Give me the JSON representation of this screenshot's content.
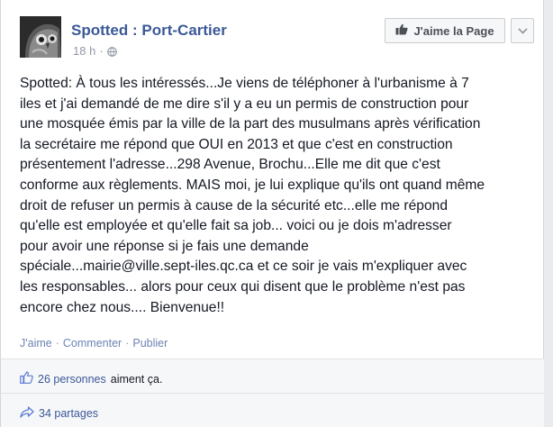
{
  "post": {
    "page_name": "Spotted : Port-Cartier",
    "time": "18 h",
    "meta_sep": "·",
    "like_page_label": "J'aime la Page",
    "text": "Spotted: À tous les intéressés...Je viens de téléphoner à l'urbanisme à 7\niles et j'ai demandé de me dire s'il y a eu un permis de construction pour\nune mosquée émis par la ville de la part des musulmans après vérification\nla secrétaire me répond que OUI en 2013 et que c'est en construction\nprésentement l'adresse...298 Avenue, Brochu...Elle me dit que c'est\nconforme aux règlements. MAIS moi, je lui explique qu'ils ont quand même\ndroit de refuser un permis à cause de la sécurité etc...elle me répond\nqu'elle est employée et qu'elle fait sa job... voici ou je dois m'adresser\npour avoir une réponse si je fais une demande\nspéciale...mairie@ville.sept-iles.qc.ca et ce soir je vais m'expliquer avec\nles responsables... alors pour ceux qui disent que le problème n'est pas\nencore chez nous.... Bienvenue!!"
  },
  "actions": {
    "like": "J'aime",
    "comment": "Commenter",
    "share": "Publier",
    "sep": "·"
  },
  "stats": {
    "likes_link": "26 personnes",
    "likes_suffix": "aiment ça.",
    "shares": "34 partages"
  },
  "icons": {
    "avatar": "spotted-owl-avatar",
    "globe": "globe-icon",
    "thumb": "thumbs-up-icon",
    "chevron": "chevron-down-icon",
    "share": "share-arrow-icon"
  },
  "colors": {
    "link": "#3b5998",
    "action_link": "#6d84b4",
    "meta": "#9197a3"
  }
}
